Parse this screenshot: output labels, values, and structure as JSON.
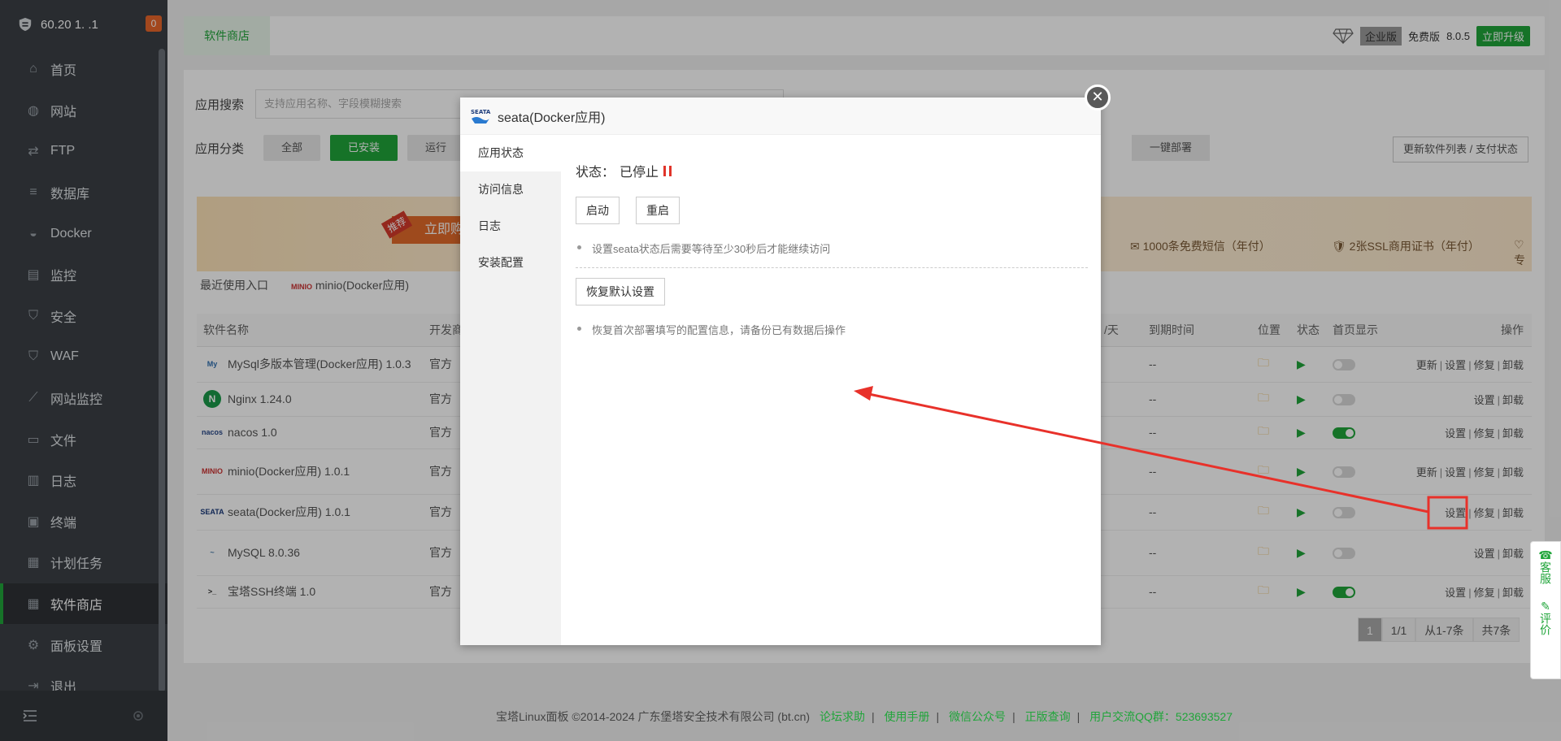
{
  "sidebar": {
    "brand_ip": "60.20 1. .1",
    "alert_count": "0",
    "items": [
      {
        "label": "首页",
        "icon": "home-icon"
      },
      {
        "label": "网站",
        "icon": "globe-icon"
      },
      {
        "label": "FTP",
        "icon": "ftp-icon"
      },
      {
        "label": "数据库",
        "icon": "database-icon"
      },
      {
        "label": "Docker",
        "icon": "docker-icon"
      },
      {
        "label": "监控",
        "icon": "monitor-icon"
      },
      {
        "label": "安全",
        "icon": "shield-icon"
      },
      {
        "label": "WAF",
        "icon": "waf-icon"
      },
      {
        "label": "网站监控",
        "icon": "chart-icon"
      },
      {
        "label": "文件",
        "icon": "folder-icon"
      },
      {
        "label": "日志",
        "icon": "log-icon"
      },
      {
        "label": "终端",
        "icon": "terminal-icon"
      },
      {
        "label": "计划任务",
        "icon": "calendar-icon"
      },
      {
        "label": "软件商店",
        "icon": "grid-icon"
      },
      {
        "label": "面板设置",
        "icon": "gear-icon"
      },
      {
        "label": "退出",
        "icon": "logout-icon"
      }
    ],
    "active_index": 13
  },
  "topbar": {
    "tab": "软件商店",
    "enterprise": "企业版",
    "free": "免费版",
    "version": "8.0.5",
    "upgrade": "立即升级"
  },
  "store": {
    "search_label": "应用搜索",
    "search_placeholder": "支持应用名称、字段模糊搜索",
    "category_label": "应用分类",
    "categories": [
      "全部",
      "已安装",
      "运行"
    ],
    "active_category": 1,
    "one_key": "一键部署",
    "refresh": "更新软件列表 / 支付状态",
    "banner": {
      "tag": "推荐",
      "buy": "立即购",
      "sms": "1000条免费短信（年付）",
      "ssl": "2张SSL商用证书（年付）",
      "more": "专"
    },
    "recent_label": "最近使用入口",
    "recent_items": [
      "minio(Docker应用)"
    ]
  },
  "table": {
    "headers": [
      "软件名称",
      "开发商",
      "/天",
      "到期时间",
      "位置",
      "状态",
      "首页显示",
      "操作"
    ],
    "rows": [
      {
        "name": "MySql多版本管理(Docker应用) 1.0.3",
        "vendor": "官方",
        "expire": "--",
        "home": false,
        "ops": [
          "更新",
          "设置",
          "修复",
          "卸载"
        ],
        "logo": "My"
      },
      {
        "name": "Nginx 1.24.0",
        "vendor": "官方",
        "expire": "--",
        "home": false,
        "ops": [
          "设置",
          "卸载"
        ],
        "logo": "N"
      },
      {
        "name": "nacos 1.0",
        "vendor": "官方",
        "expire": "--",
        "home": true,
        "ops": [
          "设置",
          "修复",
          "卸载"
        ],
        "logo": "nacos"
      },
      {
        "name": "minio(Docker应用) 1.0.1",
        "vendor": "官方",
        "expire": "--",
        "home": false,
        "ops": [
          "更新",
          "设置",
          "修复",
          "卸载"
        ],
        "logo": "MINIO"
      },
      {
        "name": "seata(Docker应用) 1.0.1",
        "vendor": "官方",
        "expire": "--",
        "home": false,
        "ops": [
          "设置",
          "修复",
          "卸载"
        ],
        "logo": "SEATA"
      },
      {
        "name": "MySQL 8.0.36",
        "vendor": "官方",
        "expire": "--",
        "home": false,
        "ops": [
          "设置",
          "卸载"
        ],
        "logo": "~"
      },
      {
        "name": "宝塔SSH终端 1.0",
        "vendor": "官方",
        "expire": "--",
        "home": true,
        "ops": [
          "设置",
          "修复",
          "卸载"
        ],
        "logo": ">_"
      }
    ]
  },
  "pager": {
    "current": "1",
    "pages": "1/1",
    "range": "从1-7条",
    "total": "共7条"
  },
  "modal": {
    "title": "seata(Docker应用)",
    "tabs": [
      "应用状态",
      "访问信息",
      "日志",
      "安装配置"
    ],
    "active_tab": 0,
    "status_label": "状态：",
    "status_value": "已停止",
    "start": "启动",
    "restart": "重启",
    "tip1": "设置seata状态后需要等待至少30秒后才能继续访问",
    "restore": "恢复默认设置",
    "tip2": "恢复首次部署填写的配置信息，请备份已有数据后操作"
  },
  "footer": {
    "copyright": "宝塔Linux面板 ©2014-2024 广东堡塔安全技术有限公司 (bt.cn)",
    "links": [
      "论坛求助",
      "使用手册",
      "微信公众号",
      "正版查询",
      "用户交流QQ群：523693527"
    ]
  },
  "float": {
    "service": "客服",
    "review": "评价"
  },
  "colors": {
    "accent": "#20a53a",
    "annotation": "#e8312a",
    "sidebar": "#3b4046"
  }
}
